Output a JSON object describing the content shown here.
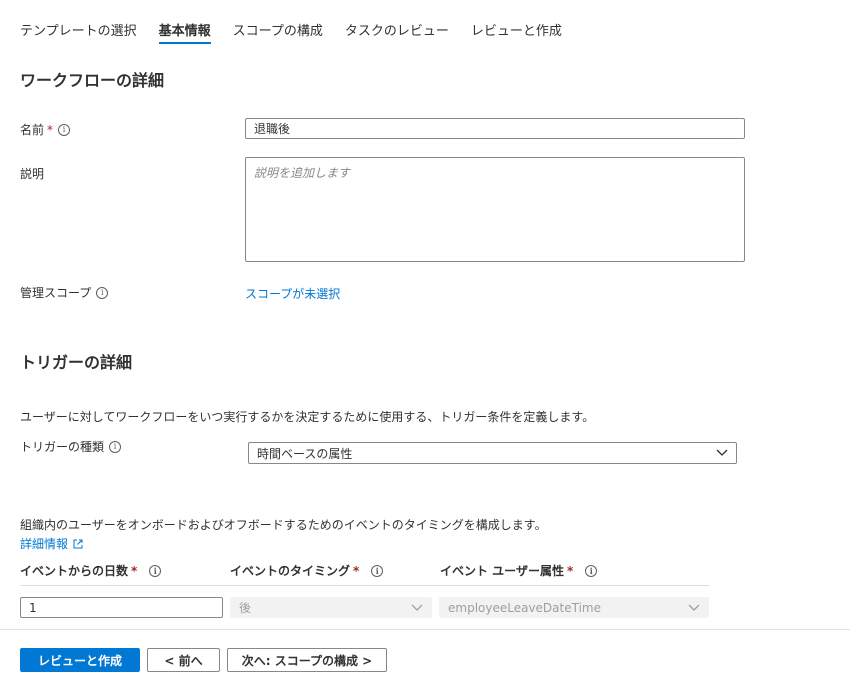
{
  "tabs": [
    "テンプレートの選択",
    "基本情報",
    "スコープの構成",
    "タスクのレビュー",
    "レビューと作成"
  ],
  "active_tab": "基本情報",
  "workflow_details": {
    "title": "ワークフローの詳細",
    "name_label": "名前",
    "required_mark": "*",
    "name_value": "退職後",
    "description_label": "説明",
    "description_placeholder": "説明を追加します",
    "admin_scope_label": "管理スコープ",
    "admin_scope_link": "スコープが未選択"
  },
  "trigger_details": {
    "title": "トリガーの詳細",
    "description": "ユーザーに対してワークフローをいつ実行するかを決定するために使用する、トリガー条件を定義します。",
    "trigger_type_label": "トリガーの種類",
    "trigger_type_value": "時間ベースの属性",
    "timing_description": "組織内のユーザーをオンボードおよびオフボードするためのイベントのタイミングを構成します。",
    "learn_more_link": "詳細情報",
    "columns": {
      "days": "イベントからの日数",
      "timing": "イベントのタイミング",
      "attribute": "イベント ユーザー属性"
    },
    "days_value": "1",
    "timing_value": "後",
    "attribute_value": "employeeLeaveDateTime"
  },
  "footer": {
    "review_create": "レビューと作成",
    "previous": "< 前へ",
    "next": "次へ: スコープの構成 >"
  },
  "colors": {
    "accent": "#0078d4",
    "required": "#a4262c",
    "text": "#323130",
    "border": "#8a8886",
    "disabled_bg": "#f3f2f1"
  }
}
